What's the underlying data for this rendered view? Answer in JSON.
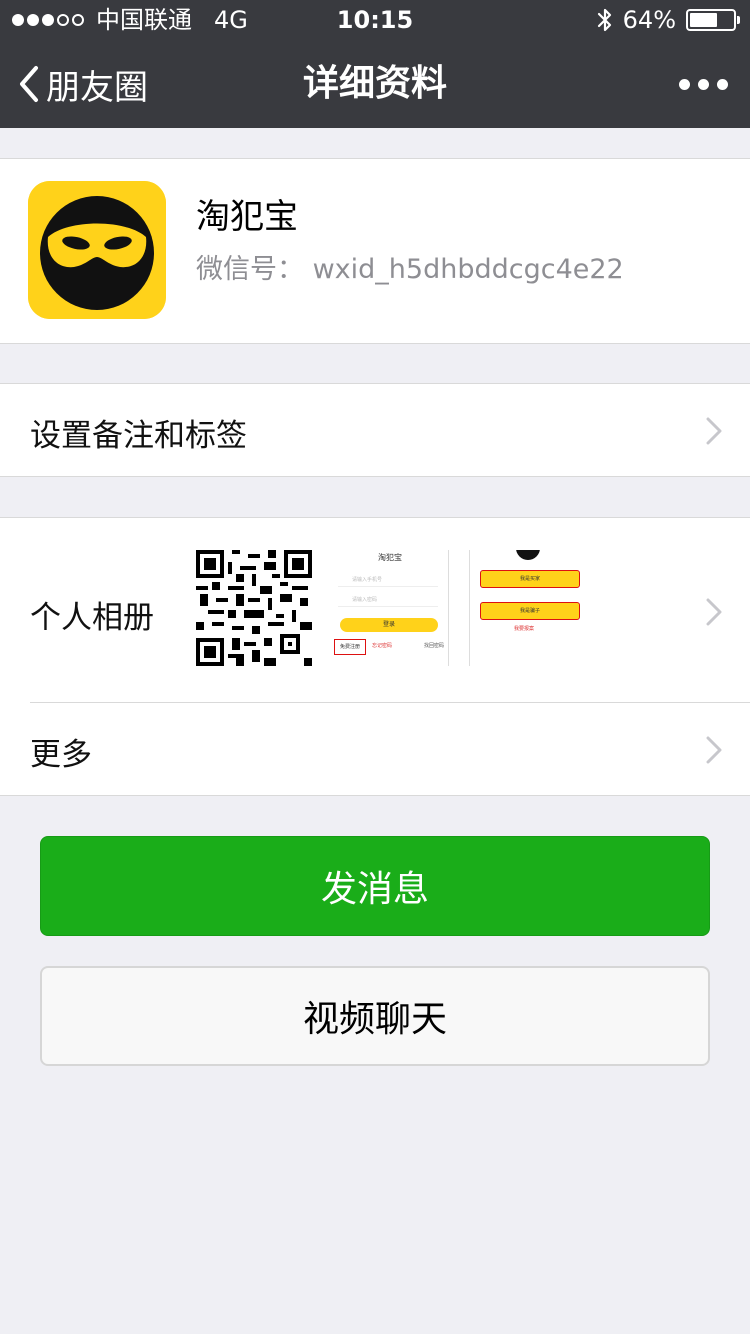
{
  "status_bar": {
    "carrier": "中国联通",
    "network": "4G",
    "time": "10:15",
    "battery": "64%",
    "battery_level": 0.64,
    "signal_bars": 3
  },
  "nav": {
    "back_label": "朋友圈",
    "title": "详细资料"
  },
  "profile": {
    "name": "淘犯宝",
    "wechat_id": "微信号： wxid_h5dhbddcgc4e22"
  },
  "rows": {
    "remark": "设置备注和标签",
    "album": "个人相册",
    "more": "更多"
  },
  "album_preview": {
    "screen_title": "淘犯宝",
    "phone_placeholder": "请输入手机号",
    "password_placeholder": "请输入密码",
    "login_button": "登录",
    "register_link": "免费注册",
    "forgot_link": "忘记密码",
    "third_link": "找回密码",
    "menu_item_1": "我是买家",
    "menu_item_2": "我是骗子",
    "menu_item_3": "我要报案"
  },
  "buttons": {
    "message": "发消息",
    "video_call": "视频聊天"
  },
  "colors": {
    "header": "#393a3f",
    "background": "#efeff4",
    "primary_green": "#1aad19",
    "avatar_yellow": "#ffd21a"
  }
}
